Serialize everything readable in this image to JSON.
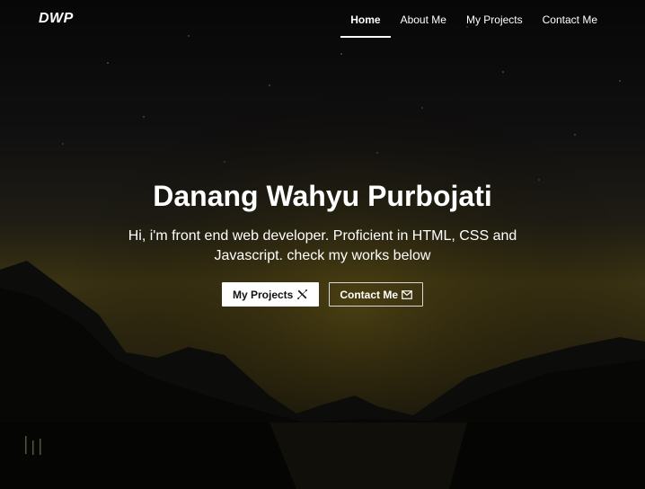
{
  "brand": "DWP",
  "nav": {
    "items": [
      {
        "label": "Home",
        "active": true
      },
      {
        "label": "About Me",
        "active": false
      },
      {
        "label": "My Projects",
        "active": false
      },
      {
        "label": "Contact Me",
        "active": false
      }
    ]
  },
  "hero": {
    "title": "Danang Wahyu Purbojati",
    "subtitle": "Hi, i'm front end web developer. Proficient in HTML, CSS and Javascript. check my works below",
    "buttons": {
      "projects": {
        "label": "My Projects",
        "icon": "tools-icon"
      },
      "contact": {
        "label": "Contact Me",
        "icon": "envelope-icon"
      }
    }
  },
  "colors": {
    "sky_top": "#080808",
    "horizon_glow": "#4a3f12",
    "mountains": "#0b0b09",
    "text": "#ffffff"
  }
}
